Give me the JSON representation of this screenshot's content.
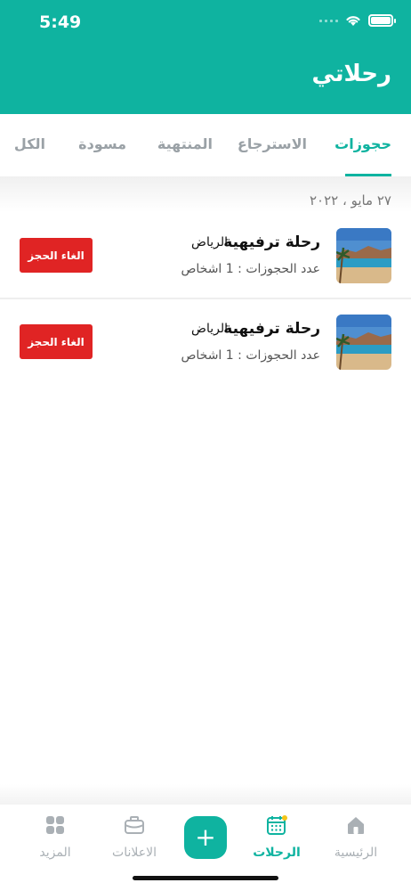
{
  "status_bar": {
    "time": "5:49"
  },
  "header": {
    "title": "رحلاتي"
  },
  "tabs": [
    {
      "label": "حجوزات",
      "active": true
    },
    {
      "label": "الاسترجاع",
      "active": false
    },
    {
      "label": "المنتهية",
      "active": false
    },
    {
      "label": "مسودة",
      "active": false
    },
    {
      "label": "الكل",
      "active": false
    }
  ],
  "date_group": "٢٧ مايو ، ٢٠٢٢",
  "trips": [
    {
      "title": "رحلة ترفيهية",
      "city": "الرياض",
      "bookings": "عدد الحجوزات : 1 اشخاص",
      "cancel_label": "الغاء الحجز",
      "image": "beach-photo"
    },
    {
      "title": "رحلة ترفيهية",
      "city": "الرياض",
      "bookings": "عدد الحجوزات : 1 اشخاص",
      "cancel_label": "الغاء الحجز",
      "image": "beach-photo"
    }
  ],
  "bottom_nav": {
    "items": [
      {
        "label": "الرئيسية",
        "icon": "home-icon",
        "active": false
      },
      {
        "label": "الرحلات",
        "icon": "calendar-icon",
        "active": true
      },
      {
        "label": "الاعلانات",
        "icon": "briefcase-icon",
        "active": false
      },
      {
        "label": "المزيد",
        "icon": "grid-icon",
        "active": false
      }
    ],
    "add_label": "+"
  },
  "colors": {
    "primary": "#0fb3a0",
    "danger": "#e02424",
    "muted": "#aab0b5",
    "notification_dot": "#f5c518"
  }
}
